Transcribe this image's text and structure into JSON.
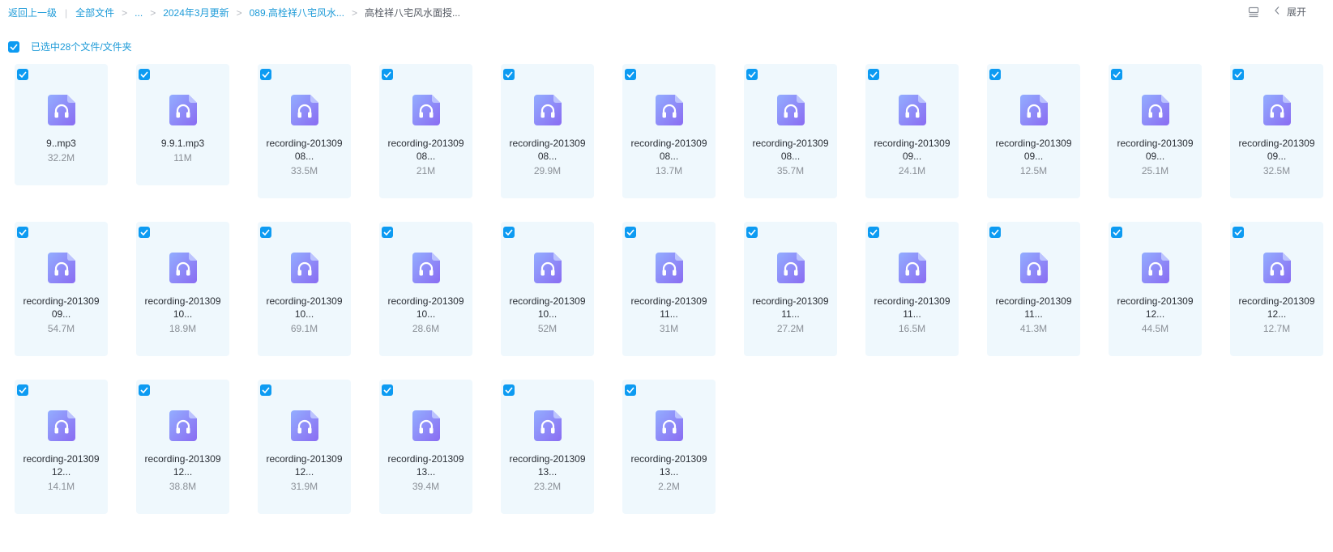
{
  "breadcrumb": {
    "back": "返回上一级",
    "all_files": "全部文件",
    "ellipsis": "...",
    "folder1": "2024年3月更新",
    "folder2": "089.高栓祥八宅风水...",
    "current": "高栓祥八宅风水面授..."
  },
  "toolbar": {
    "list_icon": "list-view-icon",
    "expand_label": "展开"
  },
  "selection": {
    "label": "已选中28个文件/文件夹",
    "checked": true
  },
  "colors": {
    "accent": "#0d9bf2",
    "link": "#1e9bd8",
    "card_bg": "#eff8fd",
    "icon_from": "#8fa7ff",
    "icon_to": "#8a6cf2"
  },
  "files": [
    {
      "name": "9..mp3",
      "size": "32.2M",
      "icon": "audio-headphones-icon",
      "checked": true
    },
    {
      "name": "9.9.1.mp3",
      "size": "11M",
      "icon": "audio-headphones-icon",
      "checked": true
    },
    {
      "name": "recording-201309 08...",
      "size": "33.5M",
      "icon": "audio-headphones-icon",
      "checked": true
    },
    {
      "name": "recording-201309 08...",
      "size": "21M",
      "icon": "audio-headphones-icon",
      "checked": true
    },
    {
      "name": "recording-201309 08...",
      "size": "29.9M",
      "icon": "audio-headphones-icon",
      "checked": true
    },
    {
      "name": "recording-201309 08...",
      "size": "13.7M",
      "icon": "audio-headphones-icon",
      "checked": true
    },
    {
      "name": "recording-201309 08...",
      "size": "35.7M",
      "icon": "audio-headphones-icon",
      "checked": true
    },
    {
      "name": "recording-201309 09...",
      "size": "24.1M",
      "icon": "audio-headphones-icon",
      "checked": true
    },
    {
      "name": "recording-201309 09...",
      "size": "12.5M",
      "icon": "audio-headphones-icon",
      "checked": true
    },
    {
      "name": "recording-201309 09...",
      "size": "25.1M",
      "icon": "audio-headphones-icon",
      "checked": true
    },
    {
      "name": "recording-201309 09...",
      "size": "32.5M",
      "icon": "audio-headphones-icon",
      "checked": true
    },
    {
      "name": "recording-201309 09...",
      "size": "54.7M",
      "icon": "audio-headphones-icon",
      "checked": true
    },
    {
      "name": "recording-201309 10...",
      "size": "18.9M",
      "icon": "audio-headphones-icon",
      "checked": true
    },
    {
      "name": "recording-201309 10...",
      "size": "69.1M",
      "icon": "audio-headphones-icon",
      "checked": true
    },
    {
      "name": "recording-201309 10...",
      "size": "28.6M",
      "icon": "audio-headphones-icon",
      "checked": true
    },
    {
      "name": "recording-201309 10...",
      "size": "52M",
      "icon": "audio-headphones-icon",
      "checked": true
    },
    {
      "name": "recording-201309 11...",
      "size": "31M",
      "icon": "audio-headphones-icon",
      "checked": true
    },
    {
      "name": "recording-201309 11...",
      "size": "27.2M",
      "icon": "audio-headphones-icon",
      "checked": true
    },
    {
      "name": "recording-201309 11...",
      "size": "16.5M",
      "icon": "audio-headphones-icon",
      "checked": true
    },
    {
      "name": "recording-201309 11...",
      "size": "41.3M",
      "icon": "audio-headphones-icon",
      "checked": true
    },
    {
      "name": "recording-201309 12...",
      "size": "44.5M",
      "icon": "audio-headphones-icon",
      "checked": true
    },
    {
      "name": "recording-201309 12...",
      "size": "12.7M",
      "icon": "audio-headphones-icon",
      "checked": true
    },
    {
      "name": "recording-201309 12...",
      "size": "14.1M",
      "icon": "audio-headphones-icon",
      "checked": true
    },
    {
      "name": "recording-201309 12...",
      "size": "38.8M",
      "icon": "audio-headphones-icon",
      "checked": true
    },
    {
      "name": "recording-201309 12...",
      "size": "31.9M",
      "icon": "audio-headphones-icon",
      "checked": true
    },
    {
      "name": "recording-201309 13...",
      "size": "39.4M",
      "icon": "audio-headphones-icon",
      "checked": true
    },
    {
      "name": "recording-201309 13...",
      "size": "23.2M",
      "icon": "audio-headphones-icon",
      "checked": true
    },
    {
      "name": "recording-201309 13...",
      "size": "2.2M",
      "icon": "audio-headphones-icon",
      "checked": true
    }
  ]
}
